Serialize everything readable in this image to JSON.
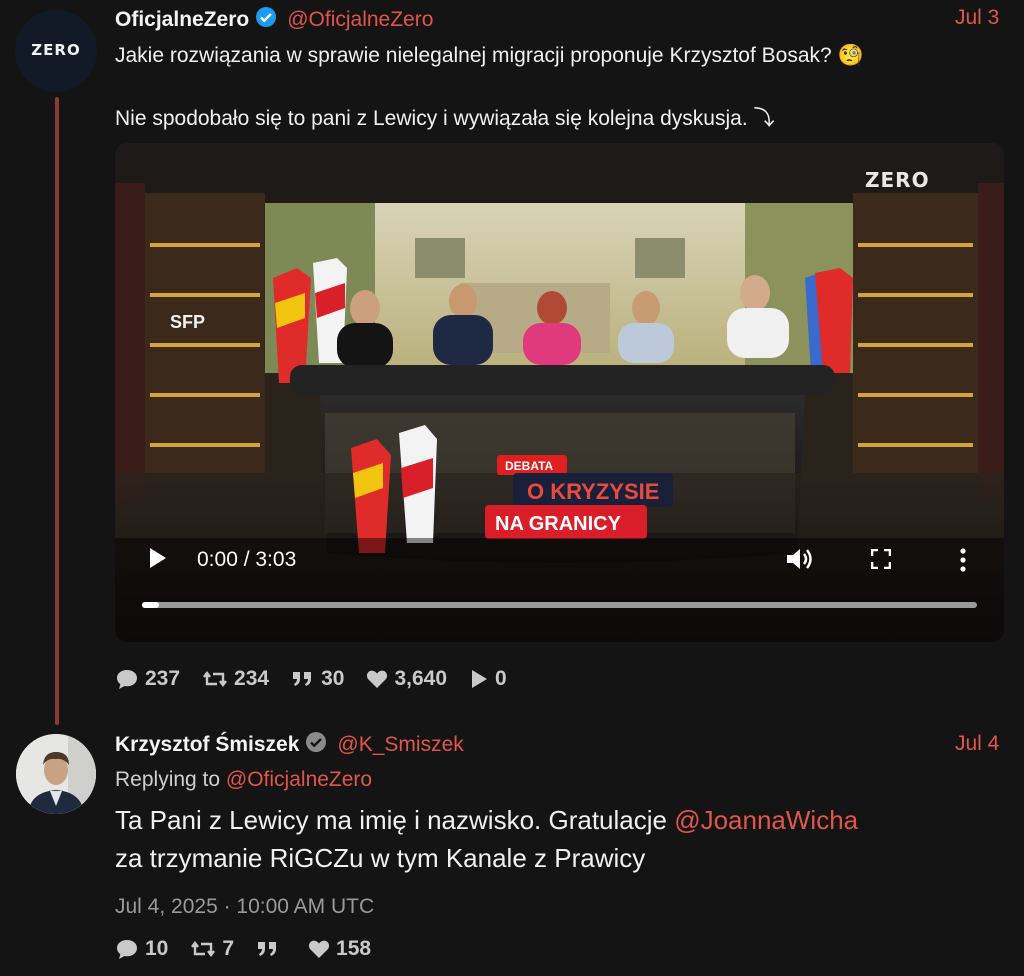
{
  "tweet1": {
    "display_name": "OficjalneZero",
    "handle": "@OficjalneZero",
    "date": "Jul 3",
    "avatar_logo": "ZERO",
    "text_line1": "Jakie rozwiązania w sprawie nielegalnej migracji proponuje Krzysztof Bosak? 🧐",
    "text_line2": "Nie spodobało się to pani z Lewicy i wywiązała się kolejna dyskusja. ⤵",
    "video": {
      "time": "0:00 / 3:03",
      "progress": 0.02,
      "channel_logo": "ZERO",
      "banner_small": "DEBATA",
      "banner_line1": "O KRYZYSIE",
      "banner_line2": "NA GRANICY",
      "studio_sign": "SFP"
    },
    "stats": {
      "replies": "237",
      "retweets": "234",
      "quotes": "30",
      "likes": "3,640",
      "views": "0"
    }
  },
  "tweet2": {
    "display_name": "Krzysztof Śmiszek",
    "handle": "@K_Smiszek",
    "date": "Jul 4",
    "replying_prefix": "Replying to ",
    "replying_to": "@OficjalneZero",
    "text_part1": "Ta Pani z Lewicy ma imię i nazwisko. Gratulacje ",
    "text_mention": "@JoannaWicha",
    "text_line2": "za trzymanie RiGCZu w tym Kanale z Prawicy",
    "timestamp": "Jul 4, 2025 · 10:00 AM UTC",
    "stats": {
      "replies": "10",
      "retweets": "7",
      "quotes": "",
      "likes": "158"
    }
  },
  "colors": {
    "background": "#141414",
    "accent": "#e0564a",
    "thread_line": "#8a3b33"
  }
}
